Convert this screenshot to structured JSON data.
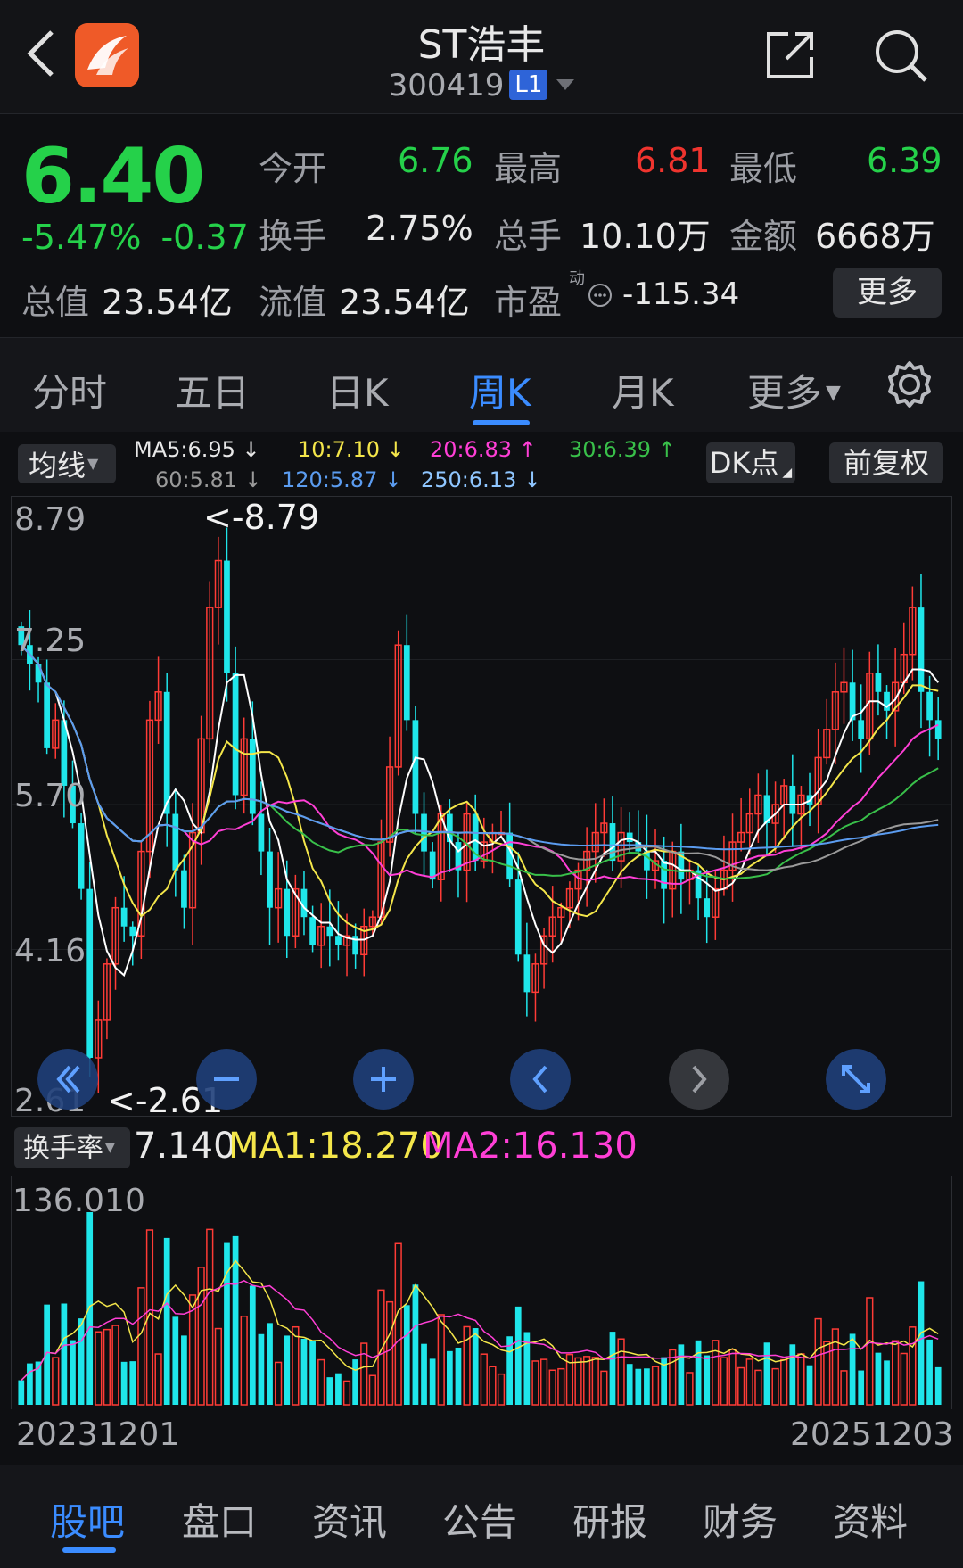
{
  "header": {
    "title": "ST浩丰",
    "code": "300419",
    "level_badge": "L1"
  },
  "quote": {
    "price": "6.40",
    "change_pct": "-5.47%",
    "change_abs": "-0.37",
    "open_label": "今开",
    "open": "6.76",
    "high_label": "最高",
    "high": "6.81",
    "low_label": "最低",
    "low": "6.39",
    "turnover_label": "换手",
    "turnover": "2.75%",
    "volume_label": "总手",
    "volume": "10.10万",
    "amount_label": "金额",
    "amount": "6668万",
    "mcap_label": "总值",
    "mcap": "23.54亿",
    "float_label": "流值",
    "float_cap": "23.54亿",
    "pe_label": "市盈",
    "pe_super": "动",
    "pe": "-115.34",
    "more_button": "更多"
  },
  "tabs": {
    "items": [
      "分时",
      "五日",
      "日K",
      "周K",
      "月K",
      "更多"
    ],
    "active": "周K"
  },
  "ma_panel": {
    "type_button": "均线",
    "ma5": "MA5:6.95 ↓",
    "ma10": "10:7.10 ↓",
    "ma20": "20:6.83 ↑",
    "ma30": "30:6.39 ↑",
    "ma60": "60:5.81 ↓",
    "ma120": "120:5.87 ↓",
    "ma250": "250:6.13 ↓",
    "dk_button": "DK点",
    "adjust_button": "前复权"
  },
  "chart_data": {
    "type": "candlestick",
    "period": "weekly",
    "y_ticks": [
      "8.79",
      "7.25",
      "5.70",
      "4.16",
      "2.61"
    ],
    "ylim": [
      2.61,
      8.79
    ],
    "max_marker": "<-8.79",
    "min_marker": "<-2.61",
    "closes": [
      7.4,
      7.2,
      7.0,
      6.3,
      6.6,
      5.9,
      5.5,
      4.8,
      3.0,
      3.4,
      4.0,
      4.6,
      4.4,
      4.3,
      5.2,
      6.6,
      6.9,
      5.6,
      5.0,
      4.6,
      5.4,
      6.4,
      7.8,
      8.3,
      7.1,
      5.8,
      6.4,
      5.6,
      5.2,
      4.6,
      4.8,
      4.3,
      4.8,
      4.5,
      4.2,
      4.4,
      4.3,
      4.2,
      4.3,
      4.1,
      4.4,
      4.5,
      5.3,
      6.1,
      7.4,
      6.6,
      5.6,
      5.2,
      4.9,
      5.6,
      5.3,
      5.0,
      5.6,
      5.1,
      5.3,
      5.4,
      5.4,
      4.9,
      4.1,
      3.7,
      4.0,
      4.3,
      4.5,
      4.6,
      4.8,
      5.0,
      5.2,
      5.4,
      5.5,
      5.1,
      5.4,
      5.3,
      5.2,
      5.0,
      5.1,
      4.8,
      5.2,
      4.9,
      5.0,
      4.7,
      4.5,
      4.8,
      5.0,
      5.3,
      5.4,
      5.6,
      5.8,
      5.5,
      5.7,
      5.9,
      5.6,
      5.8,
      5.7,
      6.2,
      6.5,
      6.9,
      7.0,
      6.6,
      6.4,
      7.1,
      6.9,
      6.7,
      7.0,
      7.3,
      7.8,
      6.9,
      6.6,
      6.4
    ]
  },
  "turnover_panel": {
    "button": "换手率",
    "value": "7.140",
    "ma1": "MA1:18.270",
    "ma2": "MA2:16.130",
    "max_label": "136.010"
  },
  "dates": {
    "start": "20231201",
    "end": "20251203"
  },
  "bottom_nav": {
    "items": [
      "股吧",
      "盘口",
      "资讯",
      "公告",
      "研报",
      "财务",
      "资料"
    ],
    "active": "股吧"
  }
}
